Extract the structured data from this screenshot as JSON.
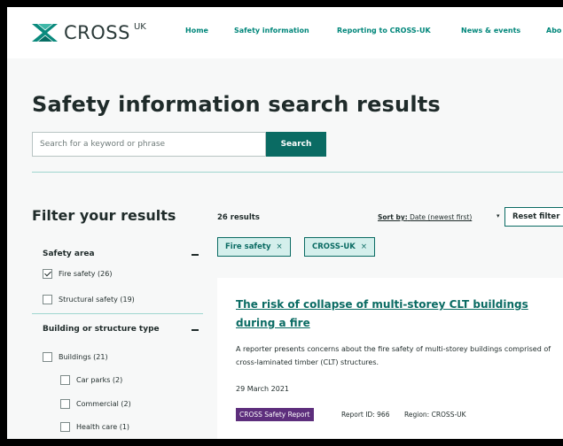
{
  "header": {
    "logo_text": "CROSS",
    "logo_suffix": "UK",
    "nav": [
      "Home",
      "Safety information",
      "Reporting to CROSS-UK",
      "News & events",
      "Abo"
    ]
  },
  "page": {
    "title": "Safety information search results",
    "search": {
      "placeholder": "Search for a keyword or phrase",
      "button_label": "Search"
    }
  },
  "filters": {
    "title": "Filter your results",
    "groups": [
      {
        "heading": "Safety area",
        "options": [
          {
            "label": "Fire safety (26)",
            "checked": true
          },
          {
            "label": "Structural safety (19)",
            "checked": false
          }
        ]
      },
      {
        "heading": "Building or structure type",
        "options": [
          {
            "label": "Buildings (21)",
            "checked": false
          },
          {
            "label": "Car parks (2)",
            "checked": false
          },
          {
            "label": "Commercial (2)",
            "checked": false
          },
          {
            "label": "Health care (1)",
            "checked": false
          }
        ]
      }
    ]
  },
  "results": {
    "count": "26 results",
    "sort_label": "Sort by:",
    "sort_value": "Date (newest first)",
    "reset_label": "Reset filter",
    "active_filters": [
      "Fire safety",
      "CROSS-UK"
    ],
    "chip_remove_glyph": "×"
  },
  "card": {
    "title": "The risk of collapse of multi-storey CLT buildings during a fire",
    "description": "A reporter presents concerns about the fire safety of multi-storey buildings comprised of cross-laminated timber (CLT) structures.",
    "date": "29 March 2021",
    "badge": "CROSS Safety Report",
    "report_id": "Report ID: 966",
    "region": "Region: CROSS-UK"
  },
  "colors": {
    "accent": "#0a6b63",
    "badge": "#5d2e7c",
    "chip_bg": "#d4efec"
  },
  "icons": {
    "logo": "cross-logo-icon",
    "checkbox_checked": "checkmark-icon",
    "collapse": "minus-icon",
    "remove_chip": "close-icon",
    "sort": "caret-down-icon"
  }
}
